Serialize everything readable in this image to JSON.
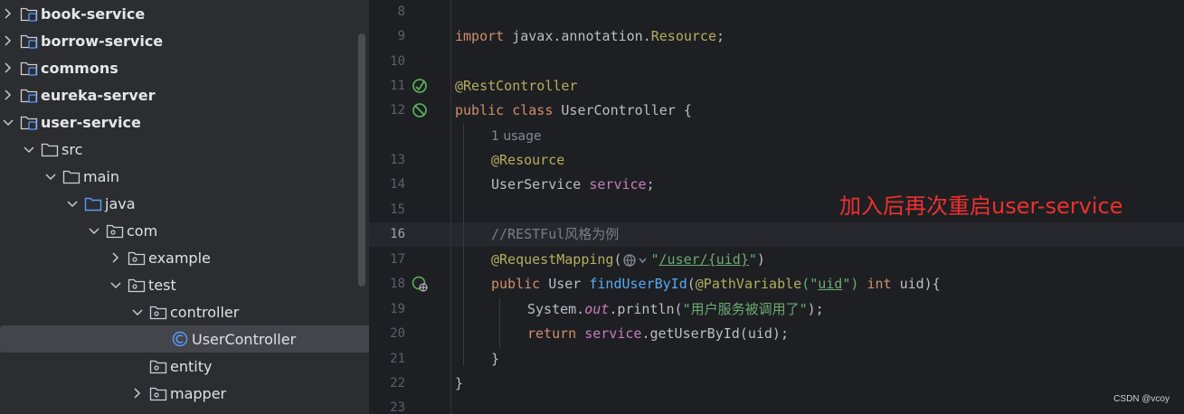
{
  "project_tree": {
    "items": [
      {
        "label": "book-service",
        "depth": 0,
        "expanded": false,
        "icon": "module-folder-icon",
        "bold": true
      },
      {
        "label": "borrow-service",
        "depth": 0,
        "expanded": false,
        "icon": "module-folder-icon",
        "bold": true
      },
      {
        "label": "commons",
        "depth": 0,
        "expanded": false,
        "icon": "module-folder-icon",
        "bold": true
      },
      {
        "label": "eureka-server",
        "depth": 0,
        "expanded": false,
        "icon": "module-folder-icon",
        "bold": true
      },
      {
        "label": "user-service",
        "depth": 0,
        "expanded": true,
        "icon": "module-folder-icon",
        "bold": true
      },
      {
        "label": "src",
        "depth": 1,
        "expanded": true,
        "icon": "folder-icon",
        "bold": false
      },
      {
        "label": "main",
        "depth": 2,
        "expanded": true,
        "icon": "folder-icon",
        "bold": false
      },
      {
        "label": "java",
        "depth": 3,
        "expanded": true,
        "icon": "source-folder-icon",
        "bold": false
      },
      {
        "label": "com",
        "depth": 4,
        "expanded": true,
        "icon": "package-icon",
        "bold": false
      },
      {
        "label": "example",
        "depth": 5,
        "expanded": false,
        "icon": "package-icon",
        "bold": false
      },
      {
        "label": "test",
        "depth": 5,
        "expanded": true,
        "icon": "package-icon",
        "bold": false
      },
      {
        "label": "controller",
        "depth": 6,
        "expanded": true,
        "icon": "package-icon",
        "bold": false
      },
      {
        "label": "UserController",
        "depth": 7,
        "expanded": null,
        "icon": "java-class-icon",
        "bold": false,
        "selected": true
      },
      {
        "label": "entity",
        "depth": 6,
        "expanded": null,
        "icon": "package-icon",
        "bold": false
      },
      {
        "label": "mapper",
        "depth": 6,
        "expanded": false,
        "icon": "package-icon",
        "bold": false
      }
    ]
  },
  "editor": {
    "current_line": "16",
    "usage_hint": "1 usage",
    "line_numbers": [
      "8",
      "9",
      "10",
      "11",
      "12",
      "13",
      "14",
      "15",
      "16",
      "17",
      "18",
      "19",
      "20",
      "21",
      "22",
      "23"
    ],
    "tokens": {
      "import_kw": "import",
      "import_pkg": "javax.annotation.",
      "import_cls": "Resource",
      "import_end": ";",
      "rest_controller": "@RestController",
      "public_kw": "public",
      "class_kw": "class",
      "class_name": "UserController {",
      "resource_ann": "@Resource",
      "service_type": "UserService",
      "service_field": "service",
      "semicolon": ";",
      "comment": "//RESTFul风格为例",
      "request_mapping": "@RequestMapping",
      "open_paren": "(",
      "mapping_q1": "\"",
      "mapping_path": "/user/",
      "mapping_var": "{uid}",
      "mapping_q2": "\"",
      "close_paren": ")",
      "user_type": "User",
      "method_name": "findUserById",
      "path_variable": "@PathVariable",
      "pv_q1": "(\"",
      "pv_arg": "uid",
      "pv_q2": "\")",
      "int_kw": "int",
      "params_end": "uid){",
      "system": "System.",
      "out_field": "out",
      "println": ".println(",
      "println_str": "\"用户服务被调用了\"",
      "println_end": ");",
      "return_kw": "return",
      "get_call": ".getUserById(uid);",
      "close_brace_inner": "}",
      "close_brace_outer": "}"
    }
  },
  "annotation_note": "加入后再次重启user-service",
  "watermark": "CSDN @vcoy",
  "colors": {
    "tree_bg": "#2b2d30",
    "editor_bg": "#1e1f22",
    "keyword": "#cf8e6d",
    "annotation": "#b3ae60",
    "field": "#c77dbb",
    "method": "#56a8f5",
    "string": "#6aab73",
    "comment": "#7a7e85",
    "note_red": "#ee3030"
  }
}
